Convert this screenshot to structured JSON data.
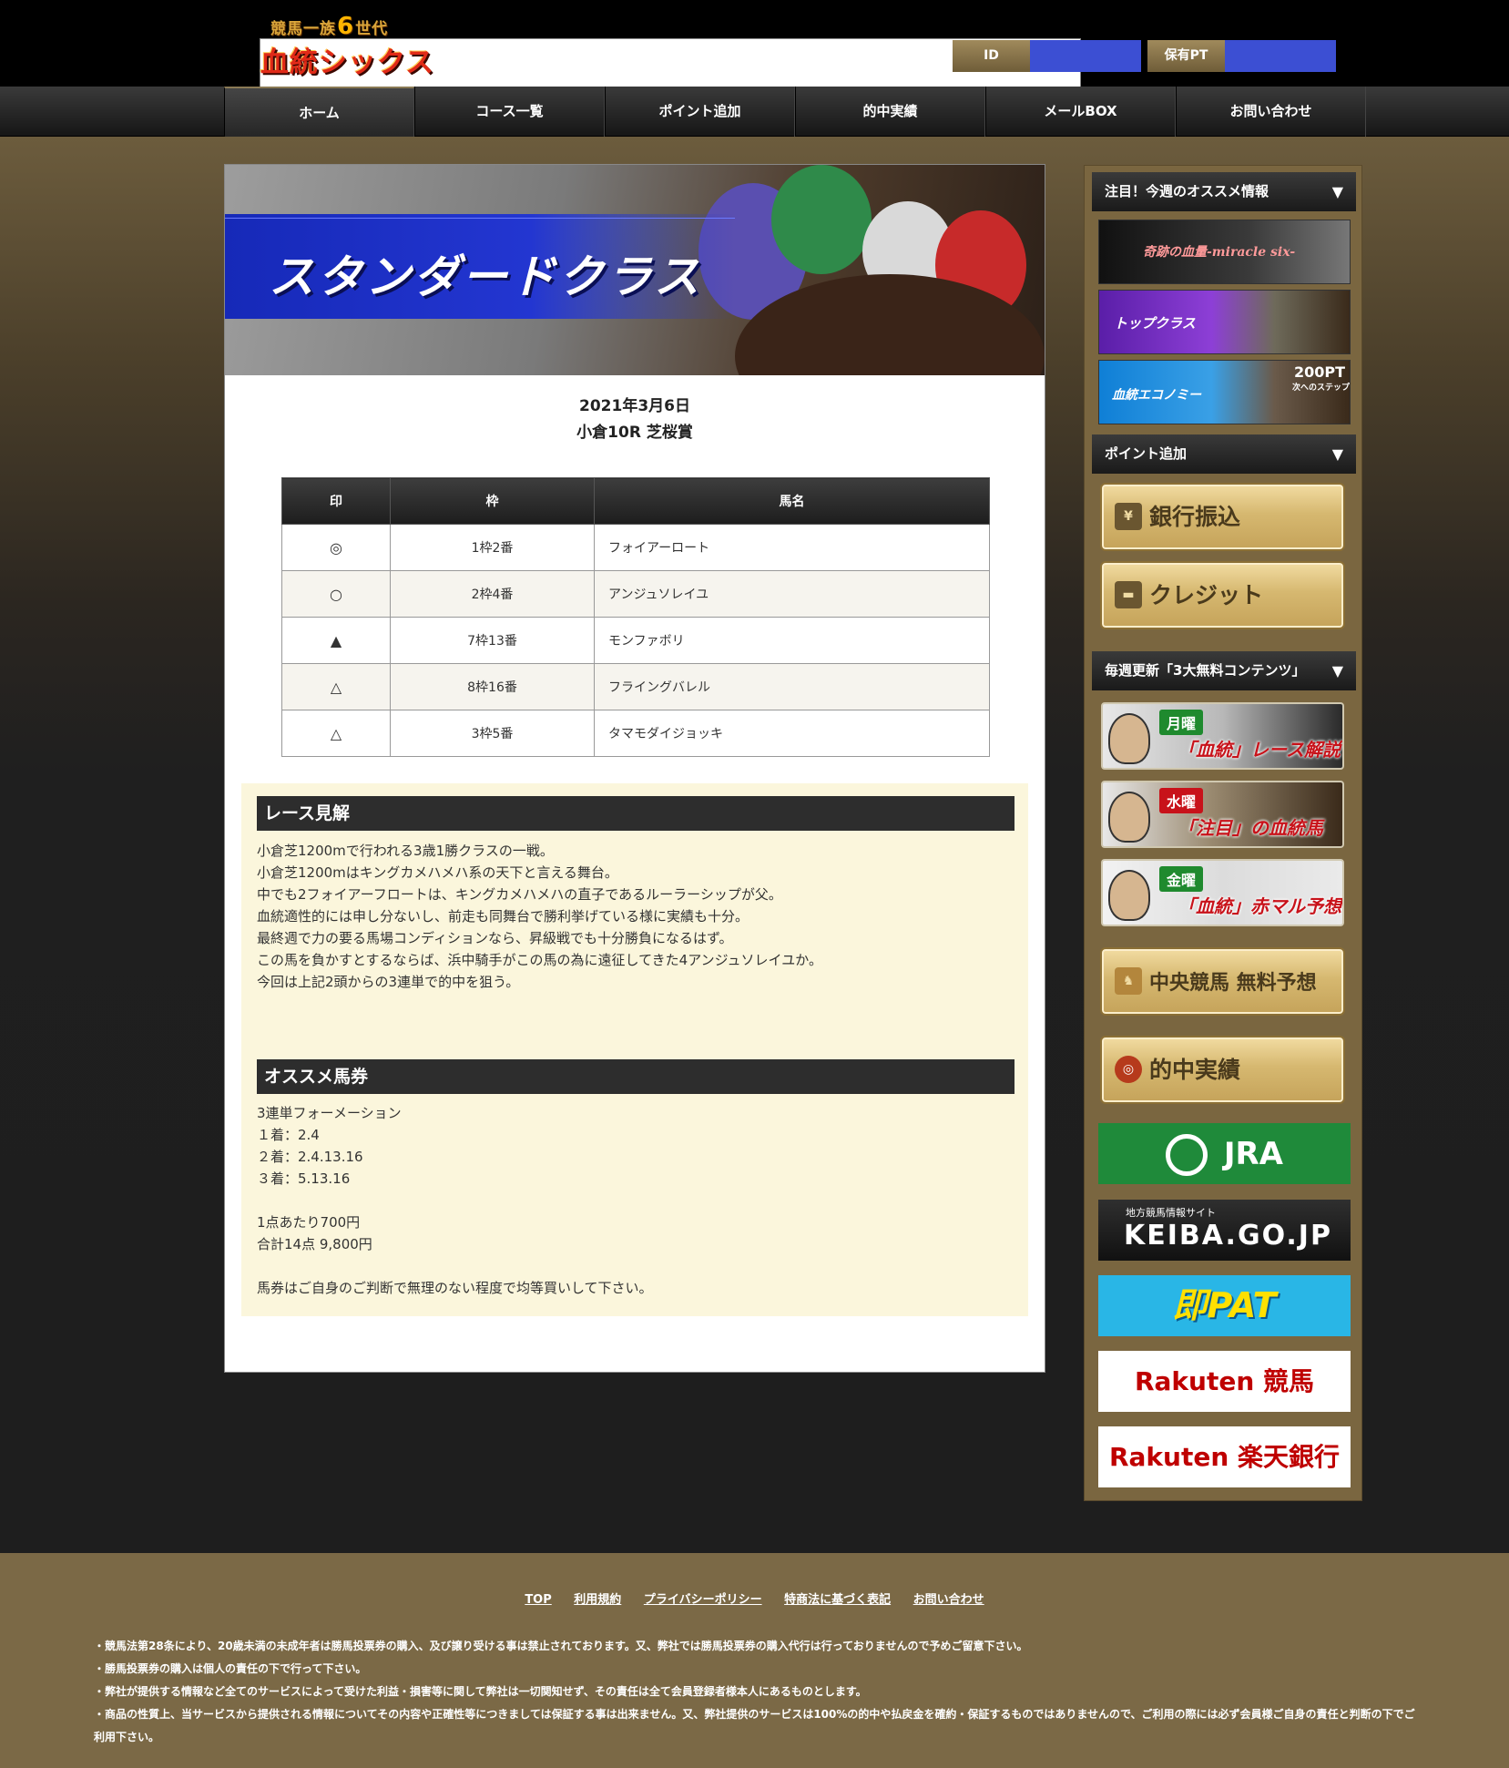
{
  "header": {
    "logo_top": "競馬一族",
    "logo_six": "6",
    "logo_top2": "世代",
    "logo_main": "血統シックス",
    "id_label": "ID",
    "points_label": "保有PT"
  },
  "nav": {
    "items": [
      "ホーム",
      "コース一覧",
      "ポイント追加",
      "的中実績",
      "メールBOX",
      "お問い合わせ"
    ]
  },
  "hero": {
    "title": "スタンダードクラス"
  },
  "race": {
    "date": "2021年3月6日",
    "name": "小倉10R 芝桜賞"
  },
  "picks": {
    "headers": [
      "印",
      "枠",
      "馬名"
    ],
    "rows": [
      {
        "mark": "◎",
        "frame": "1枠2番",
        "horse": "フォイアーロート"
      },
      {
        "mark": "○",
        "frame": "2枠4番",
        "horse": "アンジュソレイユ"
      },
      {
        "mark": "▲",
        "frame": "7枠13番",
        "horse": "モンファボリ"
      },
      {
        "mark": "△",
        "frame": "8枠16番",
        "horse": "フライングバレル"
      },
      {
        "mark": "△",
        "frame": "3枠5番",
        "horse": "タマモダイジョッキ"
      }
    ]
  },
  "analysis": {
    "heading": "レース見解",
    "lines": [
      "小倉芝1200mで行われる3歳1勝クラスの一戦。",
      "小倉芝1200mはキングカメハメハ系の天下と言える舞台。",
      "中でも2フォイアーフロートは、キングカメハメハの直子であるルーラーシップが父。",
      "血統適性的には申し分ないし、前走も同舞台で勝利挙げている様に実績も十分。",
      "最終週で力の要る馬場コンディションなら、昇級戦でも十分勝負になるはず。",
      "この馬を負かすとするならば、浜中騎手がこの馬の為に遠征してきた4アンジュソレイユか。",
      "今回は上記2頭からの3連単で的中を狙う。"
    ]
  },
  "tickets": {
    "heading": "オススメ馬券",
    "lines": [
      "3連単フォーメーション",
      "１着：2.4",
      "２着：2.4.13.16",
      "３着：5.13.16",
      "",
      "1点あたり700円",
      "合計14点 9,800円",
      "",
      "馬券はご自身のご判断で無理のない程度で均等買いして下さい。"
    ]
  },
  "sidebar": {
    "recommend_head": "注目！今週のオススメ情報",
    "arrow": "▼",
    "banners": {
      "miracle": "奇跡の血量-miracle six-",
      "top": "トップクラス",
      "economy": "血統エコノミー",
      "economy_pt": "200PT",
      "economy_sub": "次へのステップ"
    },
    "points_head": "ポイント追加",
    "bank_label": "銀行振込",
    "credit_label": "クレジット",
    "free_head": "毎週更新「3大無料コンテンツ」",
    "free": [
      {
        "day": "月曜",
        "title": "「血統」レース解説",
        "color": "#1f8a2e"
      },
      {
        "day": "水曜",
        "title": "「注目」の血統馬",
        "color": "#c8121a"
      },
      {
        "day": "金曜",
        "title": "「血統」赤マル予想",
        "color": "#1f8a2e"
      }
    ],
    "central_label": "中央競馬 無料予想",
    "results_label": "的中実績",
    "links": {
      "jra": "JRA",
      "keiba_sub": "地方競馬情報サイト",
      "keiba": "KEIBA.GO.JP",
      "sokupat": "即PAT",
      "rakuten_keiba_a": "Rakuten",
      "rakuten_keiba_b": "競馬",
      "rakuten_bank_a": "Rakuten",
      "rakuten_bank_b": "楽天銀行"
    }
  },
  "footer": {
    "links": [
      "TOP",
      "利用規約",
      "プライバシーポリシー",
      "特商法に基づく表記",
      "お問い合わせ"
    ],
    "notes": [
      "・競馬法第28条により、20歳未満の未成年者は勝馬投票券の購入、及び譲り受ける事は禁止されております。又、弊社では勝馬投票券の購入代行は行っておりませんので予めご留意下さい。",
      "・勝馬投票券の購入は個人の責任の下で行って下さい。",
      "・弊社が提供する情報など全てのサービスによって受けた利益・損害等に関して弊社は一切関知せず、その責任は全て会員登録者様本人にあるものとします。",
      "・商品の性質上、当サービスから提供される情報についてその内容や正確性等につきましては保証する事は出来ません。又、弊社提供のサービスは100%の的中や払戻金を確約・保証するものではありませんので、ご利用の際には必ず会員様ご自身の責任と判断の下でご",
      "利用下さい。"
    ]
  }
}
